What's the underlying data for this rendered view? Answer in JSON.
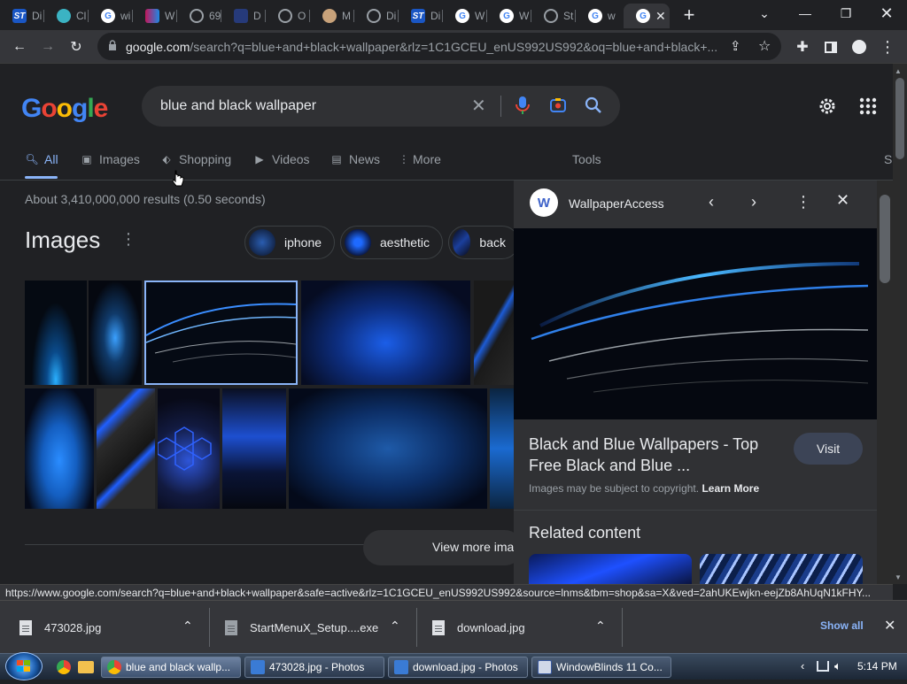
{
  "tabs": [
    {
      "label": "Di",
      "fav": "ST",
      "color": "#1a56c4"
    },
    {
      "label": "Cl",
      "fav": "",
      "color": "#3bb3c3"
    },
    {
      "label": "wi",
      "fav": "G",
      "color": "#ffffff"
    },
    {
      "label": "W",
      "fav": "",
      "color": "#c2185b"
    },
    {
      "label": "69",
      "fav": "",
      "color": "#9aa0a6"
    },
    {
      "label": "D",
      "fav": "",
      "color": "#263a7a"
    },
    {
      "label": "O",
      "fav": "",
      "color": "#9aa0a6"
    },
    {
      "label": "M",
      "fav": "",
      "color": "#c8a27a"
    },
    {
      "label": "Di",
      "fav": "",
      "color": "#9aa0a6"
    },
    {
      "label": "Di",
      "fav": "ST",
      "color": "#1a56c4"
    },
    {
      "label": "W",
      "fav": "G",
      "color": "#ffffff"
    },
    {
      "label": "W",
      "fav": "G",
      "color": "#ffffff"
    },
    {
      "label": "St",
      "fav": "",
      "color": "#9aa0a6"
    },
    {
      "label": "w",
      "fav": "G",
      "color": "#ffffff"
    }
  ],
  "toolbar": {
    "url_host": "google.com",
    "url_rest": "/search?q=blue+and+black+wallpaper&rlz=1C1GCEU_enUS992US992&oq=blue+and+black+..."
  },
  "search": {
    "logo": "Google",
    "query": "blue and black wallpaper"
  },
  "nav_tabs": {
    "all": "All",
    "images": "Images",
    "shopping": "Shopping",
    "videos": "Videos",
    "news": "News",
    "more": "More",
    "tools": "Tools",
    "partial": "S"
  },
  "results": {
    "stats": "About 3,410,000,000 results (0.50 seconds)",
    "images_heading": "Images",
    "view_more": "View more ima"
  },
  "chips": [
    "iphone",
    "aesthetic",
    "back"
  ],
  "side_panel": {
    "source": "WallpaperAccess",
    "source_logo": "W",
    "title_line1": "Black and Blue Wallpapers - Top",
    "title_line2": "Free Black and Blue ...",
    "copyright": "Images may be subject to copyright.",
    "learn_more": "Learn More",
    "visit": "Visit",
    "related": "Related content"
  },
  "status_url": "https://www.google.com/search?q=blue+and+black+wallpaper&safe=active&rlz=1C1GCEU_enUS992US992&source=lnms&tbm=shop&sa=X&ved=2ahUKEwjkn-eejZb8AhUqN1kFHY...",
  "downloads": {
    "items": [
      "473028.jpg",
      "StartMenuX_Setup....exe",
      "download.jpg"
    ],
    "show_all": "Show all"
  },
  "taskbar": {
    "items": [
      "blue and black wallp...",
      "473028.jpg - Photos",
      "download.jpg - Photos",
      "WindowBlinds 11 Co..."
    ],
    "time": "5:14 PM"
  },
  "colors": {
    "accent": "#8ab4f8",
    "bg": "#202124",
    "panel": "#303134"
  }
}
